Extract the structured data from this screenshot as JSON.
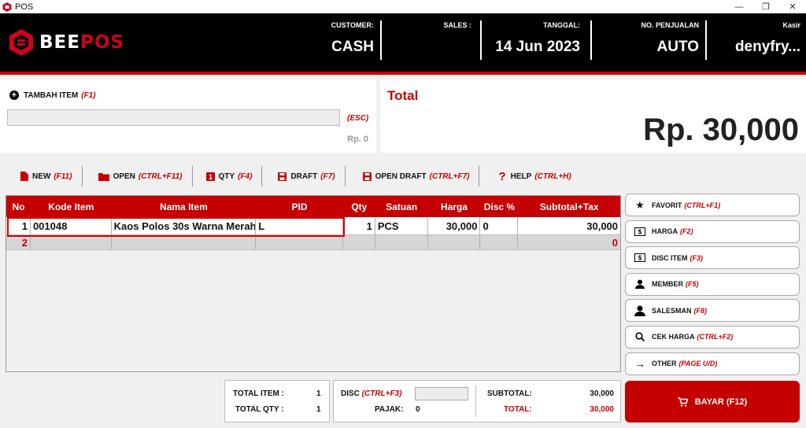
{
  "window": {
    "title": "POS"
  },
  "brand": {
    "name_part1": "BEE",
    "name_part2": "POS"
  },
  "header": {
    "customer_label": "CUSTOMER:",
    "customer_value": "CASH",
    "sales_label": "SALES :",
    "sales_value": "",
    "tanggal_label": "TANGGAL:",
    "tanggal_value": "14 Jun 2023",
    "nopenjualan_label": "NO. PENJUALAN",
    "nopenjualan_value": "AUTO",
    "kasir_label": "Kasir",
    "kasir_value": "denyfry..."
  },
  "add_item": {
    "label": "TAMBAH ITEM",
    "shortcut": "(F1)",
    "input_value": "",
    "esc": "(ESC)",
    "price": "Rp. 0"
  },
  "total": {
    "label": "Total",
    "value": "Rp. 30,000"
  },
  "toolbar": [
    {
      "label": "NEW",
      "key": "(F11)",
      "icon": "new-file-icon"
    },
    {
      "label": "OPEN",
      "key": "(CTRL+F11)",
      "icon": "folder-icon"
    },
    {
      "label": "QTY",
      "key": "(F4)",
      "icon": "qty-icon"
    },
    {
      "label": "DRAFT",
      "key": "(F7)",
      "icon": "save-icon"
    },
    {
      "label": "OPEN DRAFT",
      "key": "(CTRL+F7)",
      "icon": "save-icon"
    },
    {
      "label": "HELP",
      "key": "(CTRL+H)",
      "icon": "help-icon"
    }
  ],
  "grid": {
    "columns": [
      "No",
      "Kode Item",
      "Nama Item",
      "PID",
      "Qty",
      "Satuan",
      "Harga",
      "Disc %",
      "Subtotal+Tax"
    ],
    "rows": [
      [
        "1",
        "001048",
        "Kaos Polos 30s Warna Merah",
        "L",
        "1",
        "PCS",
        "30,000",
        "0",
        "30,000"
      ],
      [
        "2",
        "",
        "",
        "",
        "",
        "",
        "",
        "",
        "0"
      ]
    ]
  },
  "side_buttons": [
    {
      "label": "FAVORIT",
      "key": "(CTRL+F1)",
      "icon": "star-icon"
    },
    {
      "label": "HARGA",
      "key": "(F2)",
      "icon": "money-icon"
    },
    {
      "label": "DISC ITEM",
      "key": "(F3)",
      "icon": "money-icon"
    },
    {
      "label": "MEMBER",
      "key": "(F5)",
      "icon": "person-icon"
    },
    {
      "label": "SALESMAN",
      "key": "(F8)",
      "icon": "salesman-icon"
    },
    {
      "label": "CEK HARGA",
      "key": "(CTRL+F2)",
      "icon": "search-icon"
    },
    {
      "label": "OTHER",
      "key": "(PAGE U/D)",
      "icon": "arrow-right-icon"
    }
  ],
  "footer": {
    "total_item_label": "TOTAL ITEM :",
    "total_item_value": "1",
    "total_qty_label": "TOTAL QTY :",
    "total_qty_value": "1",
    "disc_label": "DISC",
    "disc_key": "(CTRL+F3)",
    "disc_value": "",
    "pajak_label": "PAJAK:",
    "pajak_value": "0",
    "subtotal_label": "SUBTOTAL:",
    "subtotal_value": "30,000",
    "total_label": "TOTAL:",
    "total_value": "30,000"
  },
  "bayar": {
    "label": "BAYAR (F12)",
    "icon": "cart-icon"
  },
  "colors": {
    "accent": "#c50000",
    "header_bg": "#000000"
  }
}
